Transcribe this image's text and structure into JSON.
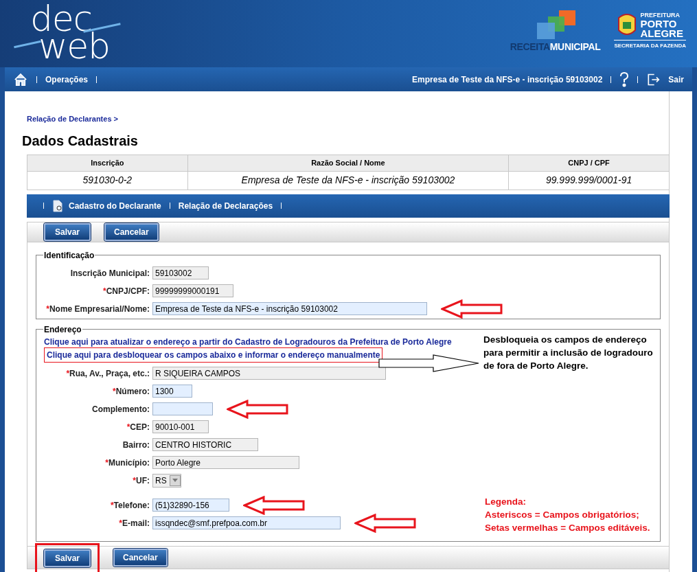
{
  "header": {
    "logo_top": "dec",
    "logo_bottom": "web",
    "receita_1": "RECEITA",
    "receita_2": "MUNICIPAL",
    "prefeitura_1": "PREFEITURA",
    "prefeitura_2": "PORTO",
    "prefeitura_3": "ALEGRE",
    "prefeitura_4": "SECRETARIA DA FAZENDA"
  },
  "navbar": {
    "items": [
      "Operações"
    ],
    "company": "Empresa de Teste da NFS-e - inscrição 59103002",
    "exit": "Sair"
  },
  "breadcrumb": "Relação de Declarantes >",
  "title": "Dados Cadastrais",
  "summary_table": {
    "columns": [
      "Inscrição",
      "Razão Social / Nome",
      "CNPJ / CPF"
    ],
    "row": [
      "591030-0-2",
      "Empresa de Teste da NFS-e - inscrição 59103002",
      "99.999.999/0001-91"
    ]
  },
  "tabs": [
    {
      "label": "Cadastro do Declarante",
      "has_icon": true
    },
    {
      "label": "Relação de Declarações",
      "has_icon": false
    }
  ],
  "toolbar_top": [
    {
      "label": "Salvar",
      "highlighted": false
    },
    {
      "label": "Cancelar",
      "highlighted": false
    }
  ],
  "fieldsets": [
    {
      "legend": "Identificação",
      "fields": [
        {
          "kind": "text",
          "label": "Inscrição Municipal:",
          "value": "59103002",
          "editable": false,
          "arrow": false
        },
        {
          "kind": "text",
          "required_mark": "*",
          "label": "CNPJ/CPF:",
          "value": "99999999000191",
          "editable": false,
          "arrow": false
        },
        {
          "kind": "text",
          "required_mark": "*",
          "label": "Nome Empresarial/Nome:",
          "value": "Empresa de Teste da NFS-e - inscrição 59103002",
          "editable": true,
          "arrow": true
        }
      ]
    },
    {
      "legend": "Endereço",
      "links": [
        {
          "text": "Clique aqui para atualizar o endereço a partir do Cadastro de Logradouros da Prefeitura de Porto Alegre",
          "boxed": false
        },
        {
          "text": "Clique aqui para desbloquear os campos abaixo e informar o endereço manualmente",
          "boxed": true
        }
      ],
      "fields": [
        {
          "kind": "text",
          "required_mark": "*",
          "label": "Rua, Av., Praça, etc.:",
          "value": "R SIQUEIRA CAMPOS",
          "editable": false,
          "arrow": false
        },
        {
          "kind": "text",
          "required_mark": "*",
          "label": "Número:",
          "value": "1300",
          "editable": true,
          "arrow": false
        },
        {
          "kind": "text",
          "label": "Complemento:",
          "editable": true,
          "arrow": true
        },
        {
          "kind": "text",
          "required_mark": "*",
          "label": "CEP:",
          "value": "90010-001",
          "editable": false,
          "arrow": false
        },
        {
          "kind": "text",
          "label": "Bairro:",
          "value": "CENTRO HISTORIC",
          "editable": false,
          "arrow": false
        },
        {
          "kind": "text",
          "required_mark": "*",
          "label": "Município:",
          "value": "Porto Alegre",
          "editable": false,
          "arrow": false
        },
        {
          "kind": "select",
          "required_mark": "*",
          "label": "UF:",
          "value": "RS",
          "editable": false,
          "arrow": false
        },
        {
          "kind": "text",
          "required_mark": "*",
          "label": "Telefone:",
          "value": "(51)32890-156",
          "editable": true,
          "arrow": true
        },
        {
          "kind": "text",
          "required_mark": "*",
          "label": "E-mail:",
          "value": "issqndec@smf.prefpoa.com.br",
          "editable": true,
          "arrow": true
        }
      ]
    }
  ],
  "toolbar_bottom": [
    {
      "label": "Salvar",
      "highlighted": true
    },
    {
      "label": "Cancelar",
      "highlighted": false
    }
  ],
  "annotations": {
    "callout": "Desbloqueia os campos de endereço para permitir a inclusão de logradouro de fora de Porto Alegre.",
    "legend": [
      "Legenda:",
      "Asteriscos = Campos obrigatórios;",
      "Setas vermelhas = Campos editáveis."
    ]
  }
}
